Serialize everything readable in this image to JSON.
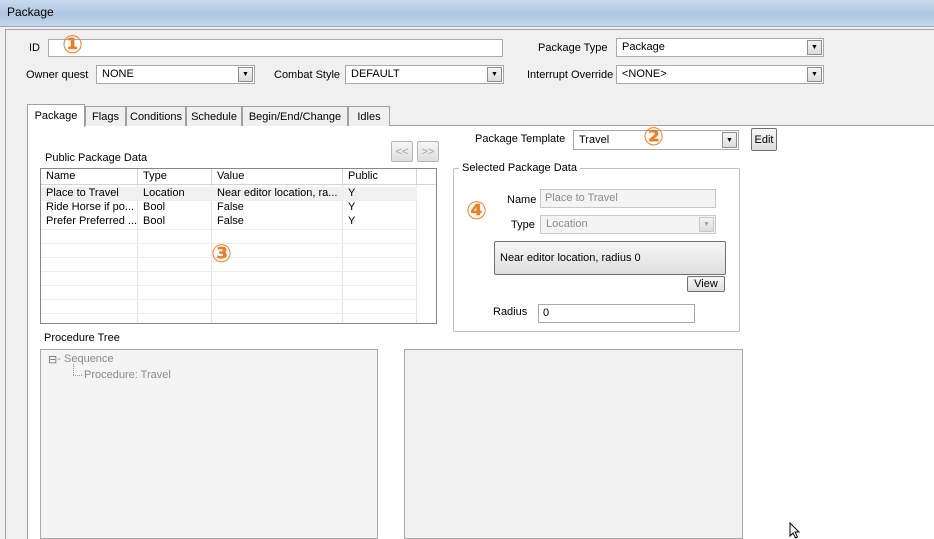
{
  "window": {
    "title": "Package"
  },
  "form": {
    "id_label": "ID",
    "id_value": "",
    "owner_quest_label": "Owner quest",
    "owner_quest_value": "NONE",
    "combat_style_label": "Combat Style",
    "combat_style_value": "DEFAULT",
    "package_type_label": "Package Type",
    "package_type_value": "Package",
    "interrupt_override_label": "Interrupt Override",
    "interrupt_override_value": "<NONE>"
  },
  "tabs": [
    {
      "label": "Package",
      "active": true
    },
    {
      "label": "Flags",
      "active": false
    },
    {
      "label": "Conditions",
      "active": false
    },
    {
      "label": "Schedule",
      "active": false
    },
    {
      "label": "Begin/End/Change",
      "active": false
    },
    {
      "label": "Idles",
      "active": false
    }
  ],
  "package_tab": {
    "public_data_label": "Public Package Data",
    "nav_prev_label": "<<",
    "nav_next_label": ">>",
    "template_label": "Package Template",
    "template_value": "Travel",
    "edit_button": "Edit",
    "table": {
      "columns": [
        "Name",
        "Type",
        "Value",
        "Public"
      ],
      "rows": [
        [
          "Place to Travel",
          "Location",
          "Near editor location, ra...",
          "Y"
        ],
        [
          "Ride Horse if po...",
          "Bool",
          "False",
          "Y"
        ],
        [
          "Prefer Preferred ...",
          "Bool",
          "False",
          "Y"
        ]
      ]
    },
    "selected": {
      "group_title": "Selected Package Data",
      "name_label": "Name",
      "name_value": "Place to Travel",
      "type_label": "Type",
      "type_value": "Location",
      "location_button": "Near editor location, radius 0",
      "view_button": "View",
      "radius_label": "Radius",
      "radius_value": "0"
    },
    "procedure_tree_label": "Procedure Tree",
    "tree": {
      "expander": "⊟",
      "root": "Sequence",
      "child": "Procedure: Travel"
    }
  },
  "annotations": {
    "marker_1": "①",
    "marker_2": "②",
    "marker_3": "③",
    "marker_4": "④",
    "color": "#f47c20"
  },
  "colors": {
    "titlebar": "#aec6e2",
    "window_bg": "#f0f0f0",
    "panel_bg": "#ffffff"
  }
}
